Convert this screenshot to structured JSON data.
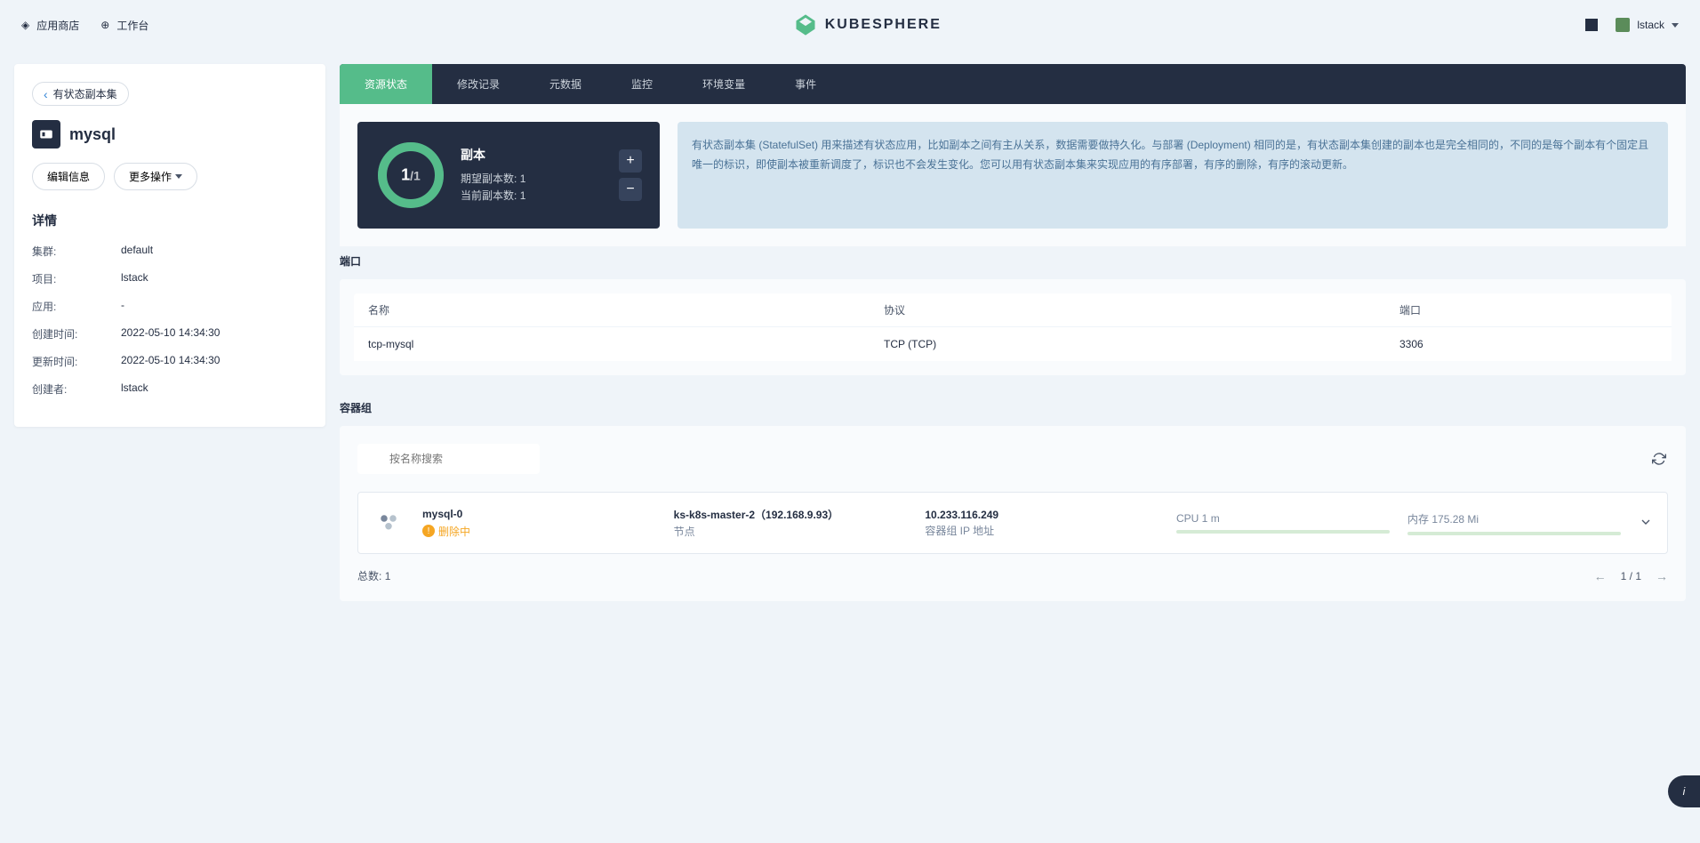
{
  "header": {
    "appstore": "应用商店",
    "workspace": "工作台",
    "logo_text": "KUBESPHERE",
    "username": "lstack"
  },
  "sidebar": {
    "breadcrumb": "有状态副本集",
    "resource_name": "mysql",
    "edit_info": "编辑信息",
    "more_actions": "更多操作",
    "details_title": "详情",
    "details": [
      {
        "label": "集群:",
        "value": "default"
      },
      {
        "label": "项目:",
        "value": "lstack"
      },
      {
        "label": "应用:",
        "value": "-"
      },
      {
        "label": "创建时间:",
        "value": "2022-05-10 14:34:30"
      },
      {
        "label": "更新时间:",
        "value": "2022-05-10 14:34:30"
      },
      {
        "label": "创建者:",
        "value": "lstack"
      }
    ]
  },
  "tabs": [
    {
      "label": "资源状态",
      "active": true
    },
    {
      "label": "修改记录",
      "active": false
    },
    {
      "label": "元数据",
      "active": false
    },
    {
      "label": "监控",
      "active": false
    },
    {
      "label": "环境变量",
      "active": false
    },
    {
      "label": "事件",
      "active": false
    }
  ],
  "status_card": {
    "current": "1",
    "total": "1",
    "title": "副本",
    "desired_label": "期望副本数:",
    "desired_value": "1",
    "current_label": "当前副本数:",
    "current_value": "1"
  },
  "info_banner": "有状态副本集 (StatefulSet) 用来描述有状态应用，比如副本之间有主从关系，数据需要做持久化。与部署 (Deployment) 相同的是，有状态副本集创建的副本也是完全相同的，不同的是每个副本有个固定且唯一的标识，即使副本被重新调度了，标识也不会发生变化。您可以用有状态副本集来实现应用的有序部署，有序的删除，有序的滚动更新。",
  "ports": {
    "title": "端口",
    "headers": {
      "name": "名称",
      "protocol": "协议",
      "port": "端口"
    },
    "rows": [
      {
        "name": "tcp-mysql",
        "protocol": "TCP (TCP)",
        "port": "3306"
      }
    ]
  },
  "pods": {
    "title": "容器组",
    "search_placeholder": "按名称搜索",
    "items": [
      {
        "name": "mysql-0",
        "status": "删除中",
        "node": "ks-k8s-master-2（192.168.9.93）",
        "node_label": "节点",
        "ip": "10.233.116.249",
        "ip_label": "容器组 IP 地址",
        "cpu_label": "CPU",
        "cpu_value": "1 m",
        "mem_label": "内存",
        "mem_value": "175.28 Mi"
      }
    ],
    "total_label": "总数:",
    "total_value": "1",
    "page": "1 / 1"
  }
}
